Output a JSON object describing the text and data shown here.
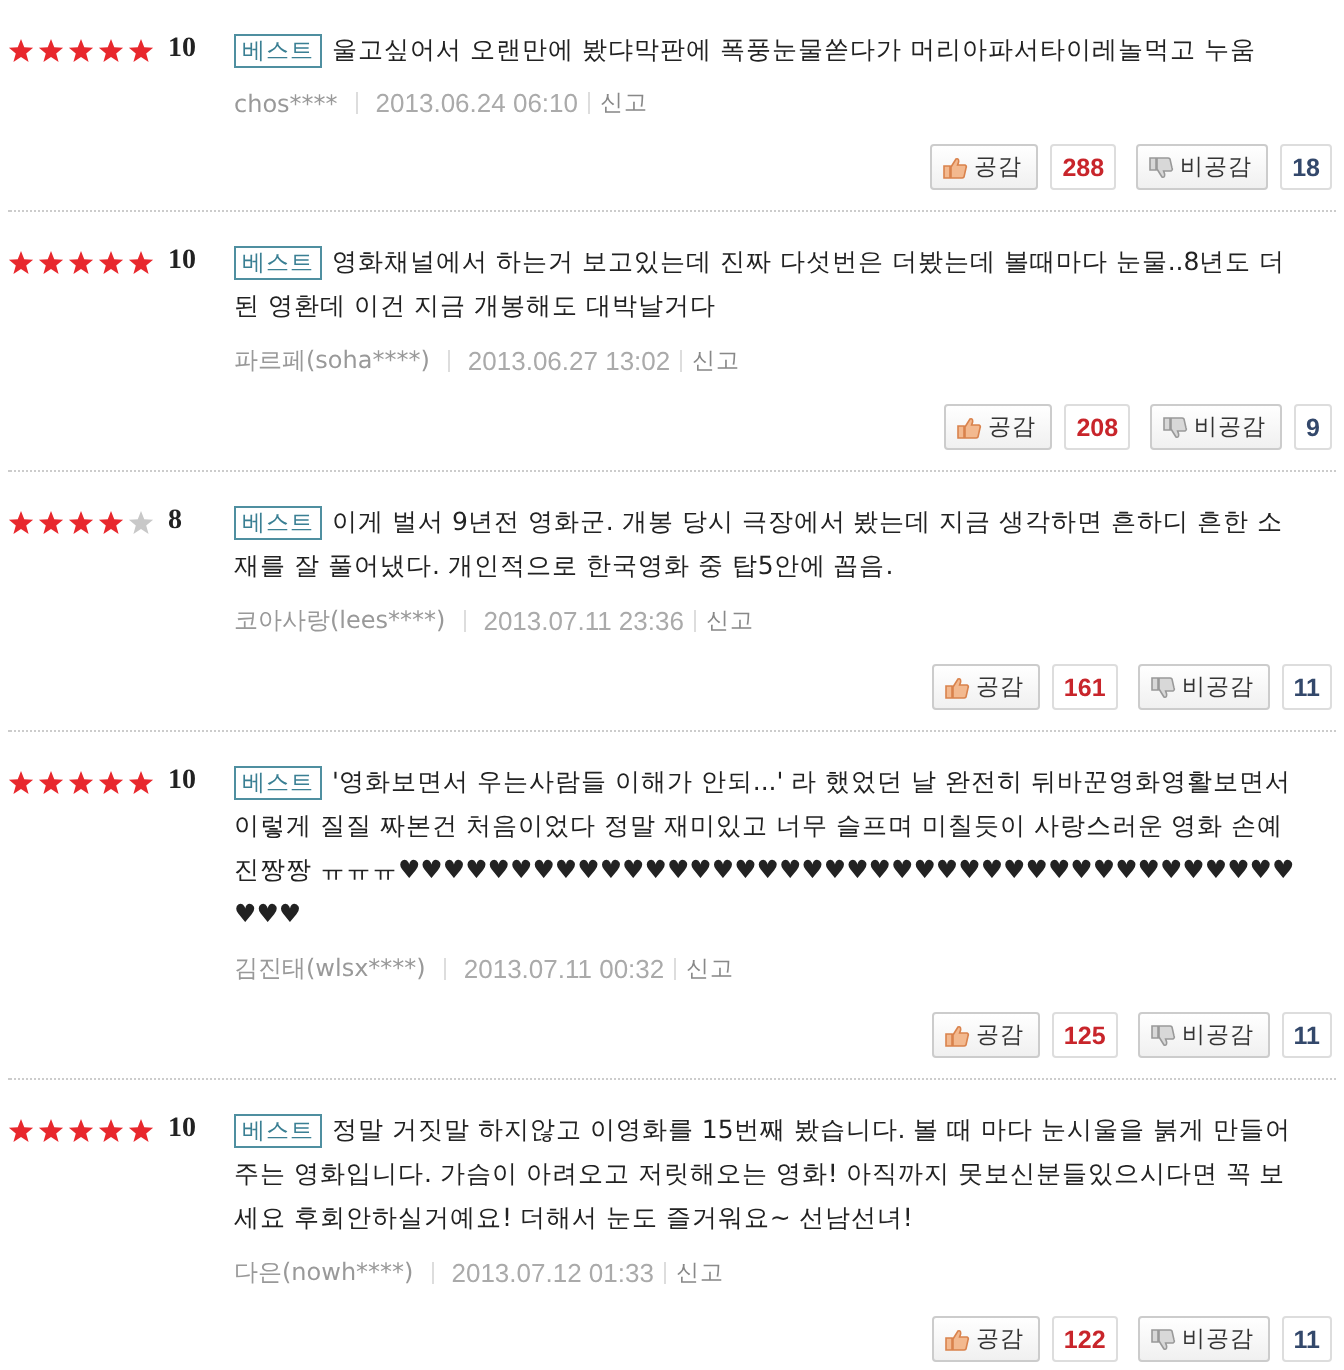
{
  "reviews": [
    {
      "stars": 5,
      "score": "10",
      "badge": "베스트",
      "text": "울고싶어서 오랜만에 봤댜막판에 폭풍눈물쏟다가 머리아파서타이레놀먹고 누움",
      "author": "chos****",
      "date": "2013.06.24 06:10",
      "report": "신고",
      "like_label": "공감",
      "likes": "288",
      "dislike_label": "비공감",
      "dislikes": "18"
    },
    {
      "stars": 5,
      "score": "10",
      "badge": "베스트",
      "text": "영화채널에서 하는거 보고있는데 진짜 다섯번은 더봤는데 볼때마다 눈물..8년도 더된 영환데 이건 지금 개봉해도 대박날거다",
      "author": "파르페(soha****)",
      "date": "2013.06.27 13:02",
      "report": "신고",
      "like_label": "공감",
      "likes": "208",
      "dislike_label": "비공감",
      "dislikes": "9"
    },
    {
      "stars": 4,
      "score": "8",
      "badge": "베스트",
      "text": "이게 벌서 9년전 영화군. 개봉 당시 극장에서 봤는데 지금 생각하면 흔하디 흔한 소재를 잘 풀어냈다. 개인적으로 한국영화 중 탑5안에 꼽음.",
      "author": "코아사랑(lees****)",
      "date": "2013.07.11 23:36",
      "report": "신고",
      "like_label": "공감",
      "likes": "161",
      "dislike_label": "비공감",
      "dislikes": "11"
    },
    {
      "stars": 5,
      "score": "10",
      "badge": "베스트",
      "text": "'영화보면서 우는사람들 이해가 안되...' 라 했었던 날 완전히 뒤바꾼영화영활보면서 이렇게 질질 짜본건 처음이었다 정말 재미있고 너무 슬프며 미칠듯이 사랑스러운 영화 손예진짱짱 ㅠㅠㅠ♥♥♥♥♥♥♥♥♥♥♥♥♥♥♥♥♥♥♥♥♥♥♥♥♥♥♥♥♥♥♥♥♥♥♥♥♥♥♥♥♥♥♥",
      "author": "김진태(wlsx****)",
      "date": "2013.07.11 00:32",
      "report": "신고",
      "like_label": "공감",
      "likes": "125",
      "dislike_label": "비공감",
      "dislikes": "11"
    },
    {
      "stars": 5,
      "score": "10",
      "badge": "베스트",
      "text": "정말 거짓말 하지않고 이영화를 15번째 봤습니다. 볼 때 마다 눈시울을 붉게 만들어 주는 영화입니다. 가슴이 아려오고 저릿해오는 영화! 아직까지 못보신분들있으시다면 꼭 보세요 후회안하실거예요! 더해서 눈도 즐거워요~ 선남선녀!",
      "author": "다은(nowh****)",
      "date": "2013.07.12 01:33",
      "report": "신고",
      "like_label": "공감",
      "likes": "122",
      "dislike_label": "비공감",
      "dislikes": "11"
    }
  ]
}
